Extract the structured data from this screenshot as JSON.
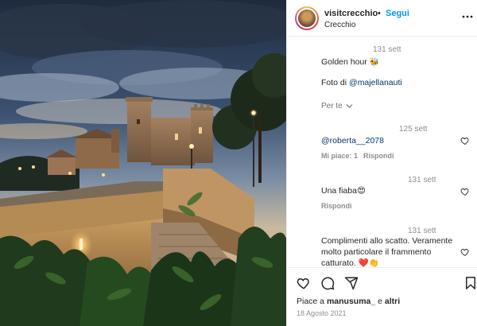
{
  "post": {
    "username": "visitcrecchio",
    "separator": "•",
    "follow_label": "Segui",
    "location": "Crecchio",
    "more_icon": "more-horizontal-icon"
  },
  "caption": {
    "time": "131 sett",
    "line1": "Golden hour",
    "line1_emoji": "🐝",
    "line2_prefix": "Foto di ",
    "line2_mention": "@majellanauti",
    "translate": "Per te",
    "translate_icon": "chevron-down-icon"
  },
  "comments": [
    {
      "time": "125 sett",
      "text": "@roberta__2078",
      "likes": "Mi piace: 1",
      "reply": "Rispondi"
    },
    {
      "time": "131 sett",
      "text": "Una fiaba",
      "emoji": "😍",
      "reply": "Rispondi"
    },
    {
      "time": "131 sett",
      "text": "Complimenti allo scatto. Veramente molto particolare il frammento catturato.",
      "line1": "Complimenti allo scatto. Veramente",
      "line2": "molto particolare il frammento",
      "line3": "catturato.",
      "emoji": "❤️👏"
    }
  ],
  "actions": {
    "like_icon": "heart-icon",
    "comment_icon": "comment-icon",
    "share_icon": "send-icon",
    "save_icon": "bookmark-icon",
    "likes_prefix": "Piace a ",
    "likes_user": "manusuma_",
    "likes_mid": " e ",
    "likes_others": "altri",
    "date": "18 Agosto 2021"
  },
  "colors": {
    "accent": "#0095f6",
    "mention": "#00376b",
    "muted": "#8e8e8e",
    "text": "#262626"
  }
}
